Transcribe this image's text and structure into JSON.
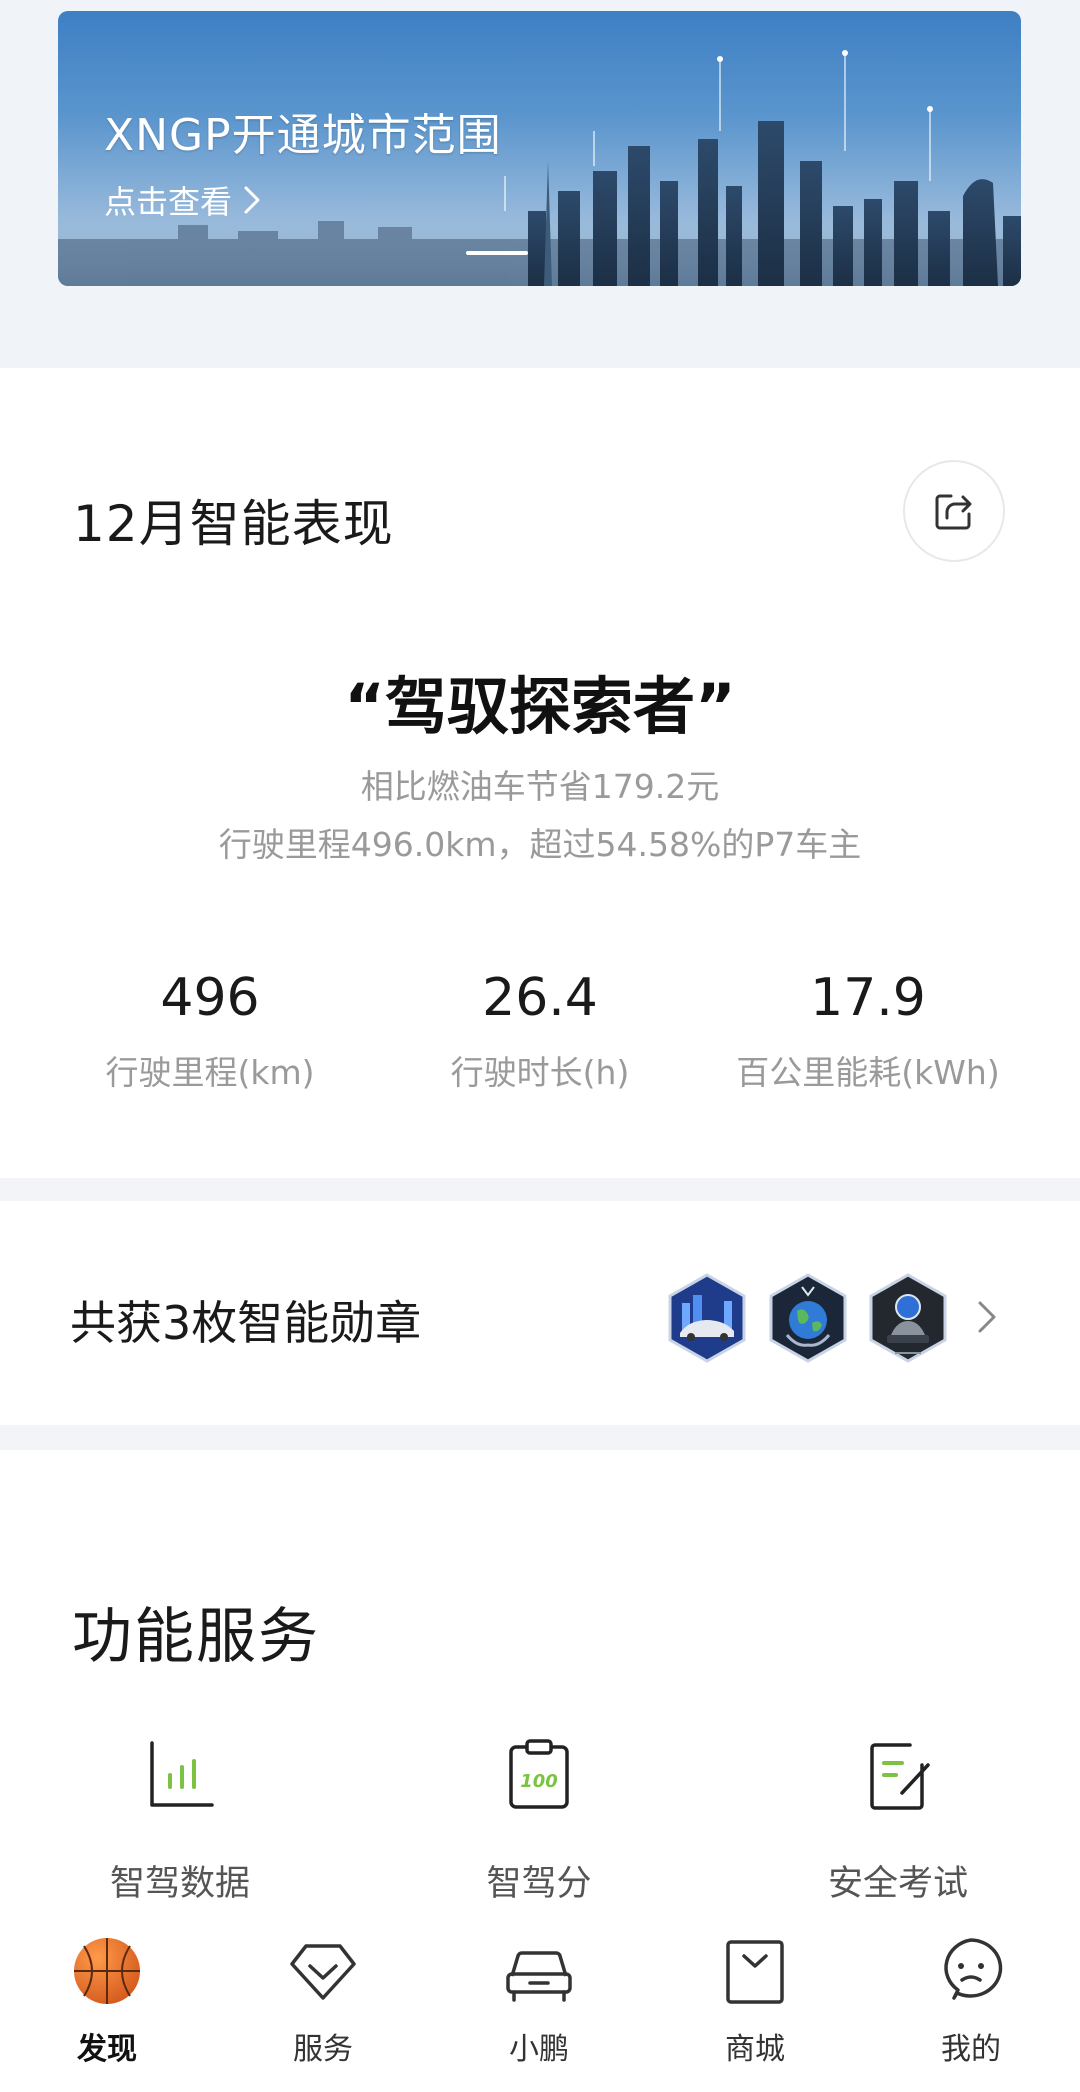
{
  "banner": {
    "title": "XNGP开通城市范围",
    "link_label": "点击查看"
  },
  "performance": {
    "title": "12月智能表现",
    "headline": "“驾驭探索者”",
    "sub_line1": "相比燃油车节省179.2元",
    "sub_line2": "行驶里程496.0km，超过54.58%的P7车主",
    "stats": [
      {
        "value": "496",
        "label": "行驶里程(km)"
      },
      {
        "value": "26.4",
        "label": "行驶时长(h)"
      },
      {
        "value": "17.9",
        "label": "百公里能耗(kWh)"
      }
    ]
  },
  "medals": {
    "title": "共获3枚智能勋章",
    "icons": [
      "car-city-medal-icon",
      "globe-medal-icon",
      "astronaut-medal-icon"
    ]
  },
  "services": {
    "title": "功能服务",
    "items": [
      {
        "label": "智驾数据",
        "icon": "bar-chart-icon"
      },
      {
        "label": "智驾分",
        "icon": "score-clipboard-icon"
      },
      {
        "label": "安全考试",
        "icon": "exam-pencil-icon"
      }
    ],
    "accent_color": "#7cc243"
  },
  "nav": {
    "items": [
      {
        "label": "发现",
        "icon": "basketball-icon",
        "active": true
      },
      {
        "label": "服务",
        "icon": "service-chevron-icon",
        "active": false
      },
      {
        "label": "小鹏",
        "icon": "car-icon",
        "active": false
      },
      {
        "label": "商城",
        "icon": "shopping-bag-icon",
        "active": false
      },
      {
        "label": "我的",
        "icon": "profile-bubble-icon",
        "active": false
      }
    ]
  }
}
